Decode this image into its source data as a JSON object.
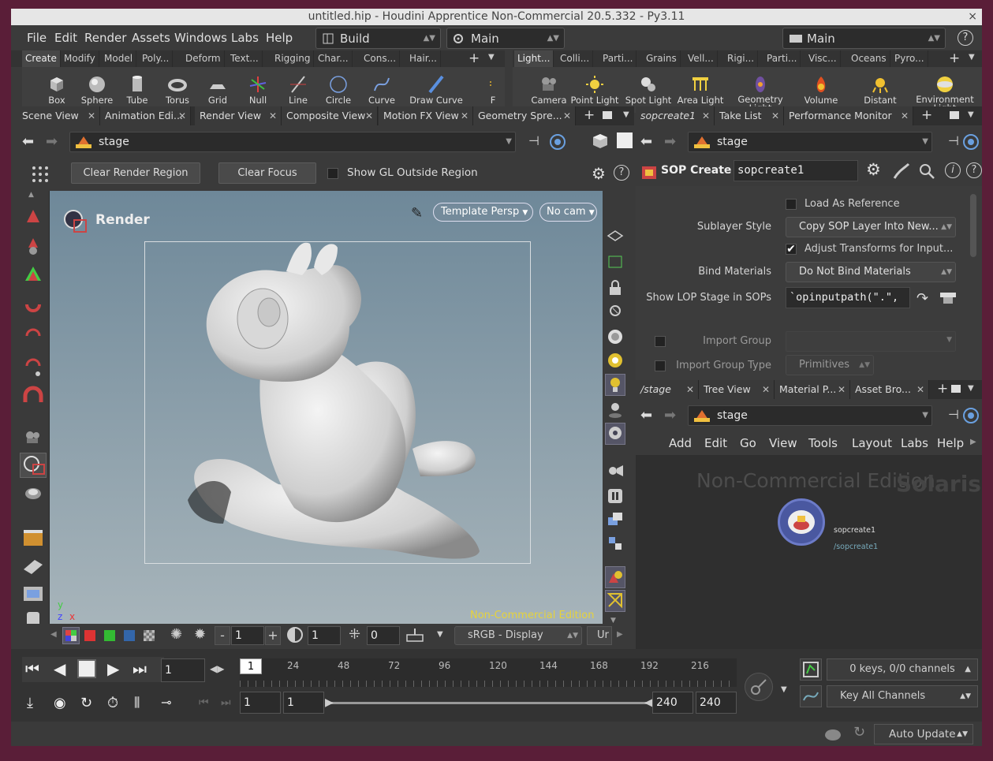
{
  "window": {
    "title": "untitled.hip - Houdini Apprentice Non-Commercial 20.5.332 - Py3.11",
    "close": "×"
  },
  "menubar": {
    "items": [
      "File",
      "Edit",
      "Render",
      "Assets",
      "Windows",
      "Labs",
      "Help"
    ],
    "desktop": "Build",
    "context": "Main",
    "right_context": "Main",
    "help": "?"
  },
  "shelf_left": {
    "tabs": [
      "Create",
      "Modify",
      "Model",
      "Poly...",
      "Deform",
      "Text...",
      "Rigging",
      "Char...",
      "Cons...",
      "Hair..."
    ],
    "tools": [
      "Box",
      "Sphere",
      "Tube",
      "Torus",
      "Grid",
      "Null",
      "Line",
      "Circle",
      "Curve Bezier",
      "Draw Curve",
      "F"
    ]
  },
  "shelf_right": {
    "tabs": [
      "Light...",
      "Colli...",
      "Parti...",
      "Grains",
      "Vell...",
      "Rigi...",
      "Parti...",
      "Visc...",
      "Oceans",
      "Pyro..."
    ],
    "tools": [
      "Camera",
      "Point Light",
      "Spot Light",
      "Area Light",
      "Geometry Light",
      "Volume Light",
      "Distant Light",
      "Environment Light"
    ]
  },
  "viewer": {
    "tabs": [
      "Scene View",
      "Animation Edi...",
      "Render View",
      "Composite View",
      "Motion FX View",
      "Geometry Spre..."
    ],
    "path": "stage",
    "clear_render_region": "Clear Render Region",
    "clear_focus": "Clear Focus",
    "show_gl": "Show GL Outside Region",
    "render_label": "Render",
    "camera_menu": "Template Persp",
    "nocam": "No cam",
    "watermark": "Non-Commercial Edition",
    "axis_y": "y",
    "axis_z": "z",
    "axis_x": "x",
    "bottom": {
      "minus": "-",
      "val1": "1",
      "plus": "+",
      "val2": "1",
      "val3": "0",
      "colorspace": "sRGB - Display",
      "ur": "Ur"
    }
  },
  "params": {
    "tabs": [
      "sopcreate1",
      "Take List",
      "Performance Monitor"
    ],
    "path": "stage",
    "node_type": "SOP Create",
    "node_name": "sopcreate1",
    "load_as_reference": "Load As Reference",
    "sublayer_style_label": "Sublayer Style",
    "sublayer_style_value": "Copy SOP Layer Into New...",
    "adjust_transforms": "Adjust Transforms for Input...",
    "bind_materials_label": "Bind Materials",
    "bind_materials_value": "Do Not Bind Materials",
    "show_lop_label": "Show LOP Stage in SOPs",
    "show_lop_value": "`opinputpath(\".\",",
    "import_group_label": "Import Group",
    "import_group_type_label": "Import Group Type",
    "import_group_type_value": "Primitives"
  },
  "network": {
    "tabs": [
      "/stage",
      "Tree View",
      "Material P...",
      "Asset Bro..."
    ],
    "path": "stage",
    "menu": [
      "Add",
      "Edit",
      "Go",
      "View",
      "Tools",
      "Layout",
      "Labs",
      "Help"
    ],
    "watermark": "Non-Commercial Edition",
    "context_label": "Solaris",
    "node_name": "sopcreate1",
    "node_path": "/sopcreate1"
  },
  "timeline": {
    "current_frame": "1",
    "frame_field": "1",
    "ticks": [
      "24",
      "48",
      "72",
      "96",
      "120",
      "144",
      "168",
      "192",
      "216"
    ],
    "start": "1",
    "start2": "1",
    "end": "240",
    "end2": "240",
    "keys": "0 keys, 0/0 channels",
    "key_all": "Key All Channels",
    "auto_update": "Auto Update"
  },
  "colors": {
    "viewport_top": "#6f8a9c",
    "viewport_bottom": "#a9b6bd",
    "watermark": "#e6d33b",
    "accent": "#3a7bc8"
  }
}
